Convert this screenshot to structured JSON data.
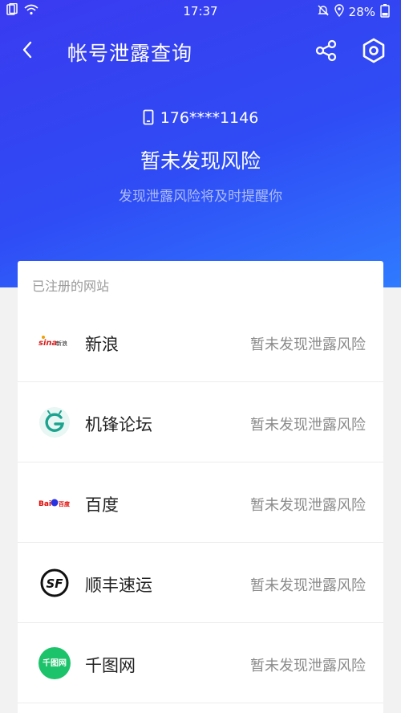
{
  "status_bar": {
    "time": "17:37",
    "battery": "28%"
  },
  "header": {
    "title": "帐号泄露查询"
  },
  "summary": {
    "phone": "176****1146",
    "headline": "暂未发现风险",
    "subtext": "发现泄露风险将及时提醒你"
  },
  "card": {
    "header": "已注册的网站",
    "sites": [
      {
        "name": "新浪",
        "status": "暂未发现泄露风险",
        "logo": "sina-logo"
      },
      {
        "name": "机锋论坛",
        "status": "暂未发现泄露风险",
        "logo": "gfan-logo"
      },
      {
        "name": "百度",
        "status": "暂未发现泄露风险",
        "logo": "baidu-logo"
      },
      {
        "name": "顺丰速运",
        "status": "暂未发现泄露风险",
        "logo": "sf-logo"
      },
      {
        "name": "千图网",
        "status": "暂未发现泄露风险",
        "logo": "58pic-logo"
      }
    ]
  },
  "colors": {
    "accent": "#2f4cf5",
    "status_text": "#8b8b8b"
  }
}
